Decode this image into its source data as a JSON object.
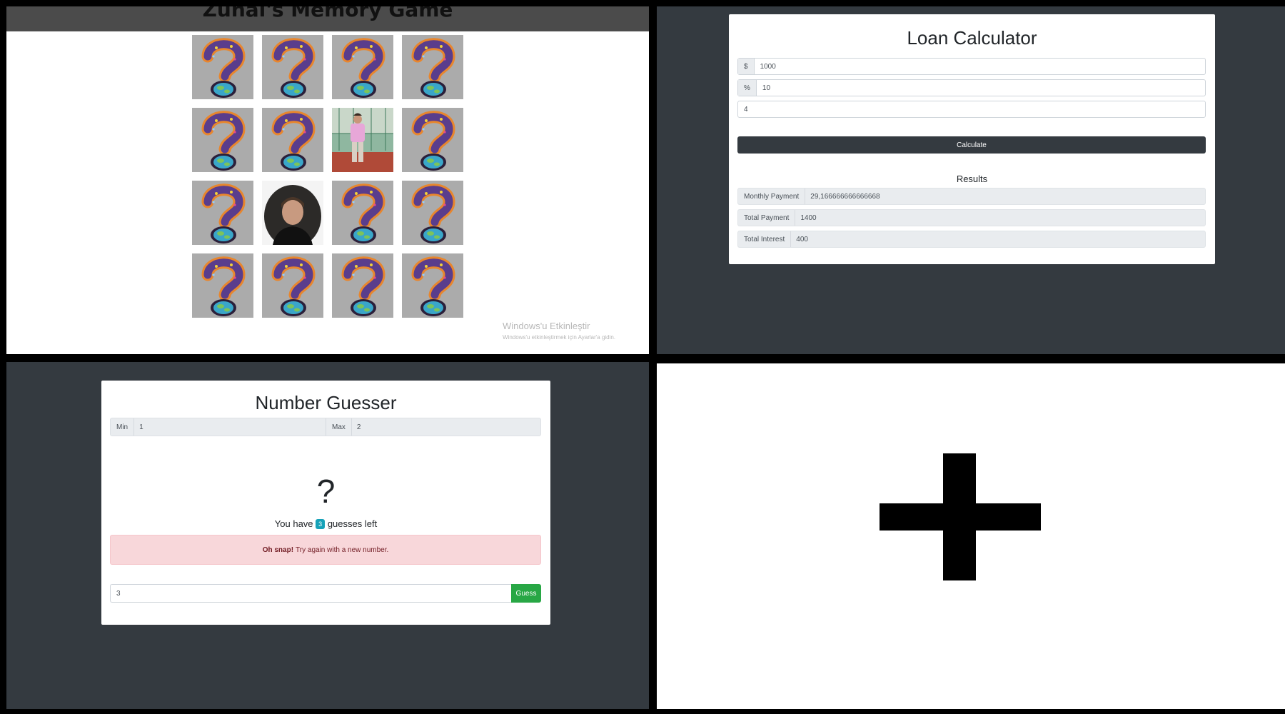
{
  "memory_game": {
    "title": "Zuhal's Memory Game",
    "cards": [
      {
        "state": "hidden",
        "face": "question-mark"
      },
      {
        "state": "hidden",
        "face": "question-mark"
      },
      {
        "state": "hidden",
        "face": "question-mark"
      },
      {
        "state": "hidden",
        "face": "question-mark"
      },
      {
        "state": "hidden",
        "face": "question-mark"
      },
      {
        "state": "hidden",
        "face": "question-mark"
      },
      {
        "state": "revealed",
        "face": "photo-person-standing"
      },
      {
        "state": "hidden",
        "face": "question-mark"
      },
      {
        "state": "hidden",
        "face": "question-mark"
      },
      {
        "state": "revealed",
        "face": "photo-person-portrait"
      },
      {
        "state": "hidden",
        "face": "question-mark"
      },
      {
        "state": "hidden",
        "face": "question-mark"
      },
      {
        "state": "hidden",
        "face": "question-mark"
      },
      {
        "state": "hidden",
        "face": "question-mark"
      },
      {
        "state": "hidden",
        "face": "question-mark"
      },
      {
        "state": "hidden",
        "face": "question-mark"
      }
    ],
    "watermark": {
      "title": "Windows'u Etkinleştir",
      "subtitle": "Windows'u etkinleştirmek için Ayarlar'a gidin."
    }
  },
  "loan_calculator": {
    "title": "Loan Calculator",
    "amount": {
      "addon": "$",
      "value": "1000"
    },
    "interest": {
      "addon": "%",
      "value": "10"
    },
    "years": {
      "value": "4"
    },
    "calculate_label": "Calculate",
    "results_heading": "Results",
    "results": {
      "monthly": {
        "label": "Monthly Payment",
        "value": "29,166666666666668"
      },
      "total": {
        "label": "Total Payment",
        "value": "1400"
      },
      "interest": {
        "label": "Total Interest",
        "value": "400"
      }
    }
  },
  "number_guesser": {
    "title": "Number Guesser",
    "min_label": "Min",
    "min_value": "1",
    "max_label": "Max",
    "max_value": "2",
    "mystery": "?",
    "guesses_prefix": "You have",
    "guesses_count": "3",
    "guesses_suffix": "guesses left",
    "alert_bold": "Oh snap!",
    "alert_text": "Try again with a new number.",
    "input_value": "3",
    "guess_label": "Guess"
  },
  "add_panel": {
    "icon": "plus-icon"
  },
  "colors": {
    "dark_panel": "#343a40",
    "guess_button": "#28a745",
    "badge": "#17a2b8",
    "alert_bg": "#f8d7da",
    "alert_text": "#721c24"
  }
}
